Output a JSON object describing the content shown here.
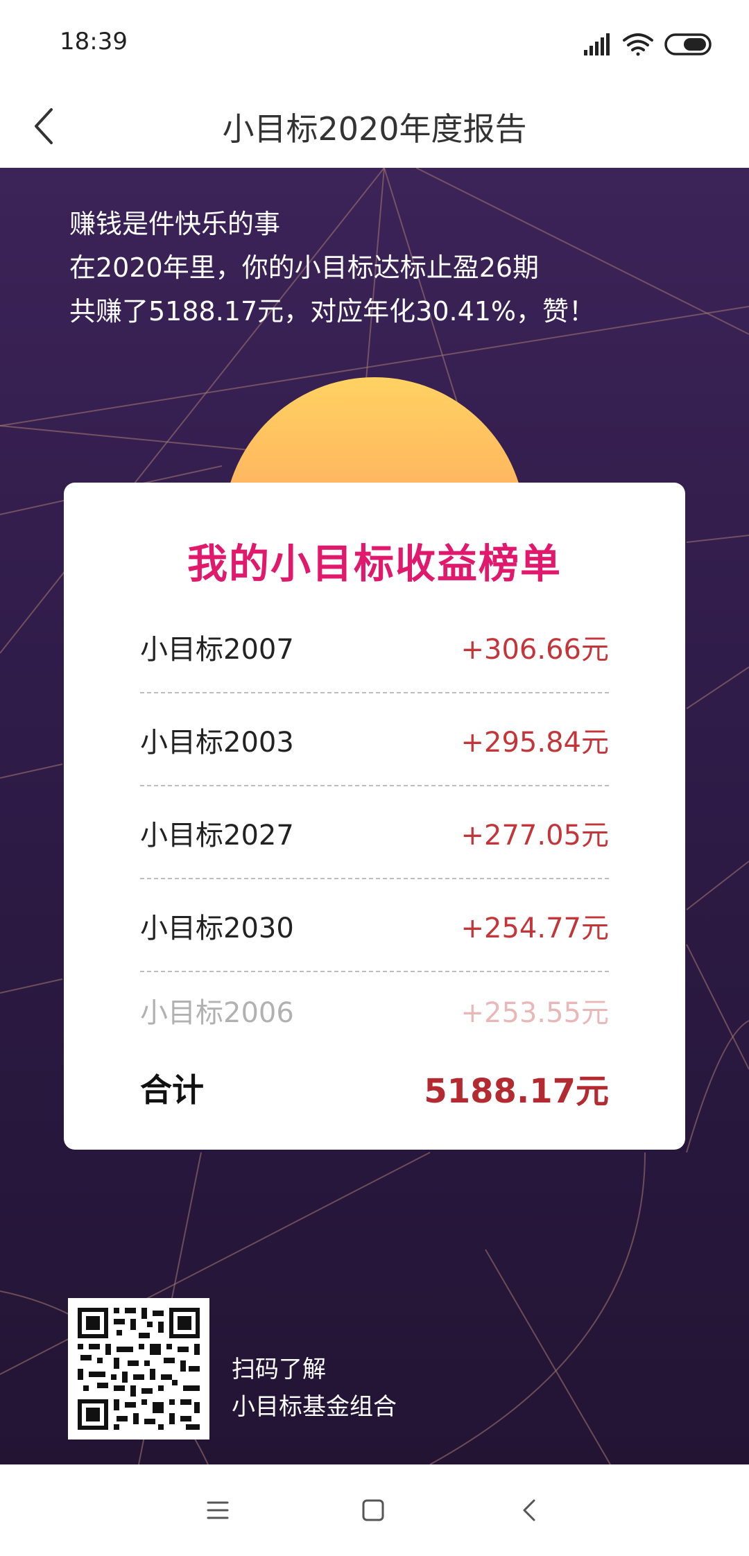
{
  "status_bar": {
    "time": "18:39",
    "icons": [
      "signal-icon",
      "wifi-icon",
      "battery-icon"
    ]
  },
  "header": {
    "back_icon": "chevron-left-icon",
    "title": "小目标2020年度报告"
  },
  "intro": {
    "line1": "赚钱是件快乐的事",
    "line2": "在2020年里，你的小目标达标止盈26期",
    "line3": "共赚了5188.17元，对应年化30.41%，赞！"
  },
  "card": {
    "title": "我的小目标收益榜单",
    "rows": [
      {
        "name": "小目标2007",
        "value": "+306.66元"
      },
      {
        "name": "小目标2003",
        "value": "+295.84元"
      },
      {
        "name": "小目标2027",
        "value": "+277.05元"
      },
      {
        "name": "小目标2030",
        "value": "+254.77元"
      },
      {
        "name": "小目标2006",
        "value": "+253.55元"
      }
    ],
    "total_label": "合计",
    "total_value": "5188.17元"
  },
  "footer": {
    "qr_icon": "qr-code-icon",
    "caption_line1": "扫码了解",
    "caption_line2": "小目标基金组合"
  },
  "nav_bar": {
    "icons": [
      "menu-icon",
      "home-square-icon",
      "back-triangle-icon"
    ]
  },
  "colors": {
    "accent_title": "#e0196d",
    "amount": "#c4353a",
    "total": "#b32a30",
    "background_top": "#3c2358",
    "background_bottom": "#231434",
    "sun_top": "#ffd262",
    "sun_bottom": "#ff8e58"
  }
}
